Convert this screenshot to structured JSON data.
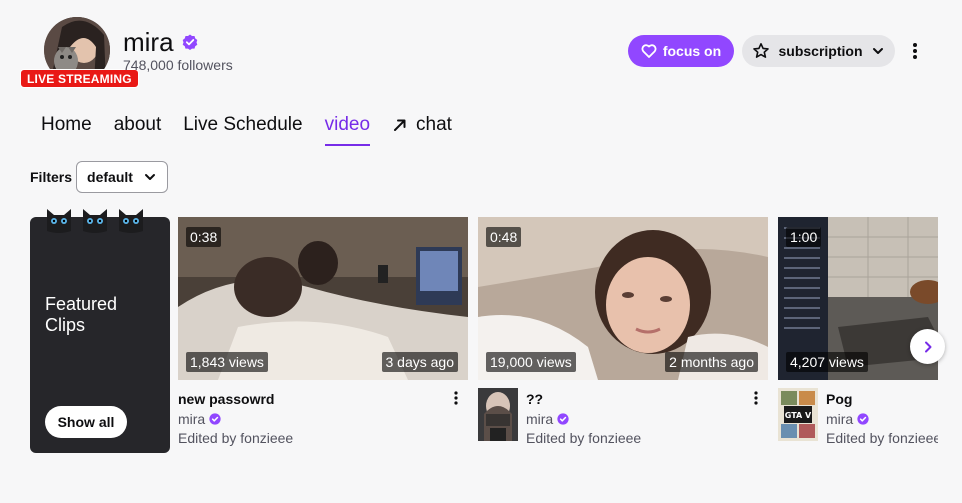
{
  "channel": {
    "name": "mira",
    "followers": "748,000 followers",
    "live_badge": "LIVE STREAMING"
  },
  "actions": {
    "follow_label": "focus on",
    "subscribe_label": "subscription"
  },
  "tabs": [
    {
      "label": "Home"
    },
    {
      "label": "about"
    },
    {
      "label": "Live Schedule"
    },
    {
      "label": "video",
      "active": true
    },
    {
      "label": "chat"
    }
  ],
  "filters": {
    "label": "Filters",
    "selected": "default"
  },
  "featured": {
    "title": "Featured Clips",
    "button": "Show all"
  },
  "clips": [
    {
      "duration": "0:38",
      "views": "1,843 views",
      "age": "3 days ago",
      "title": "new passowrd",
      "channel": "mira",
      "editor": "Edited by fonzieee"
    },
    {
      "duration": "0:48",
      "views": "19,000 views",
      "age": "2 months ago",
      "title": "??",
      "channel": "mira",
      "editor": "Edited by fonzieee"
    },
    {
      "duration": "1:00",
      "views": "4,207 views",
      "age": "",
      "title": "Pog",
      "channel": "mira",
      "editor": "Edited by fonzieee"
    }
  ],
  "colors": {
    "accent": "#9147ff",
    "accent_text": "#772ce8",
    "live": "#e91916",
    "featured_bg": "#26262a"
  },
  "icons": {
    "verified": "verified-badge-icon",
    "heart": "heart-icon",
    "star": "star-icon",
    "chevron": "chevron-down-icon",
    "more": "more-vertical-icon",
    "external": "arrow-up-right-icon",
    "next": "chevron-right-icon"
  }
}
